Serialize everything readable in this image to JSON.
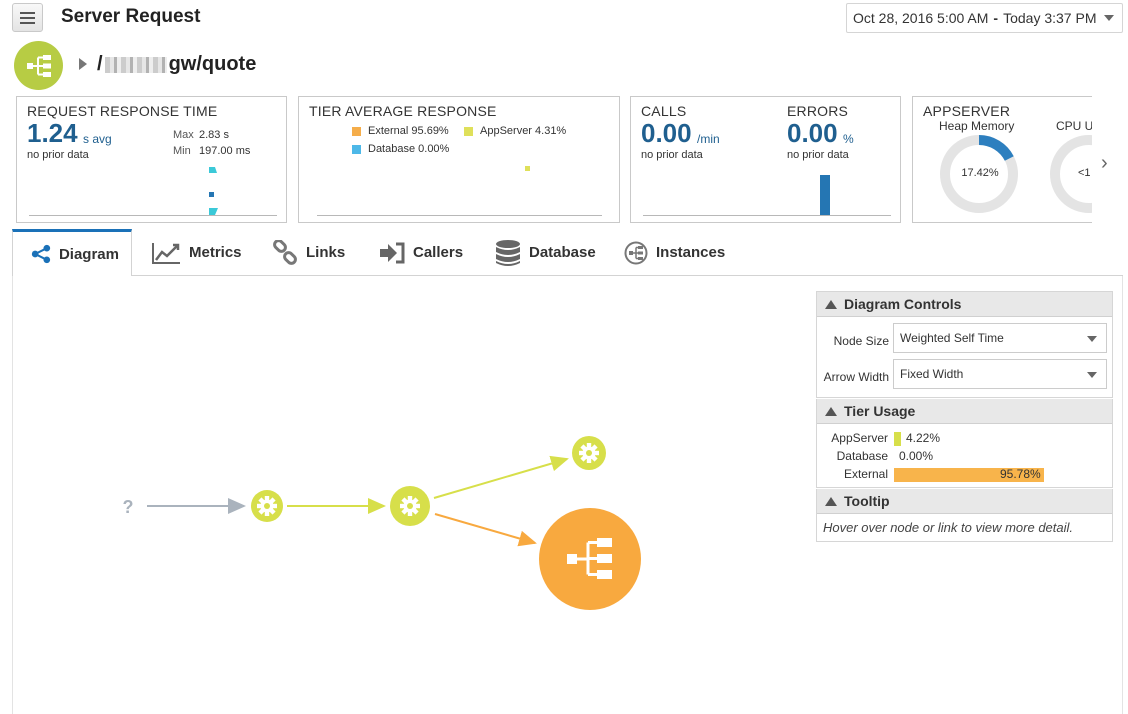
{
  "header": {
    "title": "Server Request",
    "date_from": "Oct 28, 2016 5:00 AM",
    "date_sep": "-",
    "date_to": "Today 3:37 PM"
  },
  "breadcrumb": {
    "prefix": "/",
    "suffix": "gw/quote"
  },
  "cards": {
    "response_time": {
      "title": "REQUEST RESPONSE TIME",
      "value": "1.24",
      "unit": "s avg",
      "prior": "no prior data",
      "max_label": "Max",
      "max_value": "2.83 s",
      "min_label": "Min",
      "min_value": "197.00 ms"
    },
    "tier_avg": {
      "title": "TIER AVERAGE RESPONSE",
      "legend": [
        {
          "label": "External 95.69%",
          "color": "#f5ad4a"
        },
        {
          "label": "AppServer 4.31%",
          "color": "#dfe05a"
        },
        {
          "label": "Database 0.00%",
          "color": "#4db8e8"
        }
      ]
    },
    "calls": {
      "title": "CALLS",
      "value": "0.00",
      "unit": "/min",
      "prior": "no prior data"
    },
    "errors": {
      "title": "ERRORS",
      "value": "0.00",
      "unit": "%",
      "prior": "no prior data"
    },
    "appserver": {
      "title": "APPSERVER",
      "heap_label": "Heap Memory",
      "heap_value": "17.42%",
      "heap_fraction": 0.1742,
      "cpu_label": "CPU U",
      "cpu_value": "<1"
    }
  },
  "tabs": [
    {
      "label": "Diagram",
      "icon": "share-nodes-icon",
      "active": true
    },
    {
      "label": "Metrics",
      "icon": "line-chart-icon"
    },
    {
      "label": "Links",
      "icon": "chain-link-icon"
    },
    {
      "label": "Callers",
      "icon": "arrow-in-icon"
    },
    {
      "label": "Database",
      "icon": "database-icon"
    },
    {
      "label": "Instances",
      "icon": "instances-icon"
    }
  ],
  "diagram": {
    "unknown_caller": "?",
    "nodes": [
      {
        "name": "caller-unknown",
        "type": "unknown"
      },
      {
        "name": "appserver-node-1",
        "type": "appserver",
        "icon": "gear-icon"
      },
      {
        "name": "appserver-node-2",
        "type": "appserver",
        "icon": "gear-icon"
      },
      {
        "name": "appserver-node-3",
        "type": "appserver",
        "icon": "gear-icon"
      },
      {
        "name": "external-node",
        "type": "external",
        "icon": "hierarchy-icon"
      }
    ],
    "colors": {
      "appserver": "#d7df4a",
      "external": "#f8a93f",
      "unknown": "#aab3bd"
    }
  },
  "panel": {
    "controls": {
      "title": "Diagram Controls",
      "node_size_label": "Node Size",
      "node_size_value": "Weighted Self Time",
      "arrow_width_label": "Arrow Width",
      "arrow_width_value": "Fixed Width"
    },
    "tier_usage": {
      "title": "Tier Usage",
      "rows": [
        {
          "name": "AppServer",
          "pct": "4.22%",
          "fraction": 0.0422,
          "color": "#d7df4a"
        },
        {
          "name": "Database",
          "pct": "0.00%",
          "fraction": 0.0,
          "color": "#4db8e8"
        },
        {
          "name": "External",
          "pct": "95.78%",
          "fraction": 0.9578,
          "color": "#f8b44b"
        }
      ]
    },
    "tooltip": {
      "title": "Tooltip",
      "text": "Hover over node or link to view more detail."
    }
  }
}
